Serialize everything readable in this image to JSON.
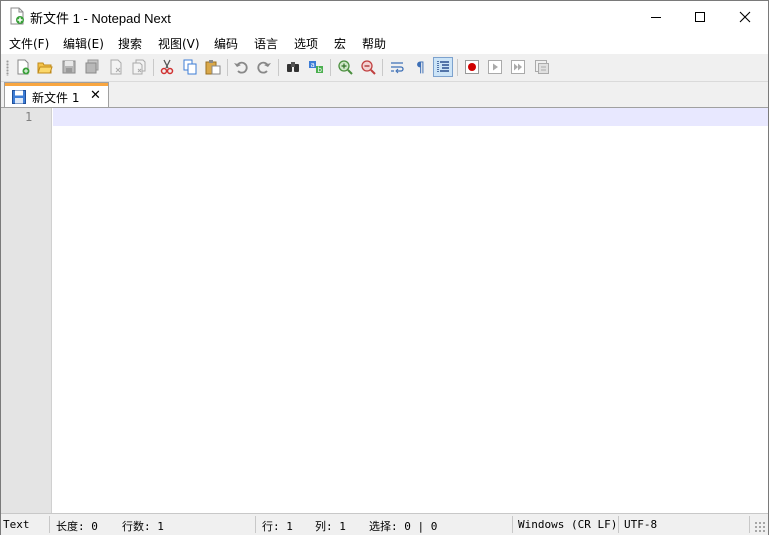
{
  "window": {
    "title": "新文件 1 - Notepad Next"
  },
  "menu": {
    "items": [
      "文件(F)",
      "编辑(E)",
      "搜索",
      "视图(V)",
      "编码",
      "语言",
      "选项",
      "宏",
      "帮助"
    ]
  },
  "toolbar": {
    "buttons": [
      "new-file-icon",
      "open-file-icon",
      "save-icon",
      "save-all-icon",
      "close-icon-doc",
      "close-all-icon",
      "cut-icon",
      "copy-icon",
      "paste-icon",
      "undo-icon",
      "redo-icon",
      "find-icon",
      "replace-icon",
      "zoom-in-icon",
      "zoom-out-icon",
      "word-wrap-icon",
      "show-all-chars-icon",
      "indent-guide-icon",
      "record-macro-icon",
      "play-macro-icon",
      "run-macro-multiple-icon",
      "save-macro-icon"
    ],
    "active": "indent-guide-icon"
  },
  "tabs": [
    {
      "label": "新文件 1",
      "close": "✕",
      "active": true
    }
  ],
  "editor": {
    "line_numbers": [
      "1"
    ],
    "content": ""
  },
  "status": {
    "language": "Text",
    "length": "长度: 0",
    "lines": "行数: 1",
    "line": "行: 1",
    "column": "列: 1",
    "selection": "选择: 0 | 0",
    "eol": "Windows (CR LF)",
    "encoding": "UTF-8"
  },
  "colors": {
    "tab_accent": "#f9a640",
    "current_line": "#e8e8ff",
    "gutter": "#e4e4e4"
  }
}
